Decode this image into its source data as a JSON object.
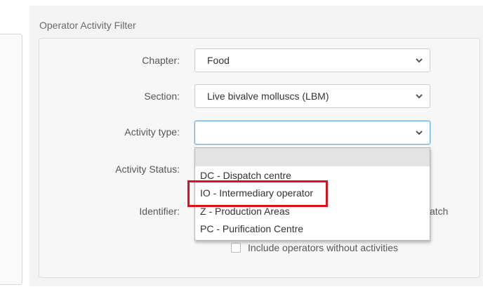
{
  "panel": {
    "title": "Operator Activity Filter"
  },
  "fields": {
    "chapter": {
      "label": "Chapter:",
      "value": "Food"
    },
    "section": {
      "label": "Section:",
      "value": "Live bivalve molluscs (LBM)"
    },
    "activity_type": {
      "label": "Activity type:",
      "value": ""
    },
    "activity_status": {
      "label": "Activity Status:"
    },
    "identifier": {
      "label": "Identifier:",
      "partial_right_text": "atch"
    }
  },
  "dropdown": {
    "options": [
      "",
      "DC - Dispatch centre",
      "IO - Intermediary operator",
      "Z - Production Areas",
      "PC - Purification Centre"
    ],
    "highlighted_option_index": 2
  },
  "checkbox": {
    "label": "Include operators without activities",
    "checked": false
  },
  "colors": {
    "highlight_border": "#e0101b",
    "focus_border": "#66afe9",
    "blank_option_bg": "#e3e3e3"
  }
}
